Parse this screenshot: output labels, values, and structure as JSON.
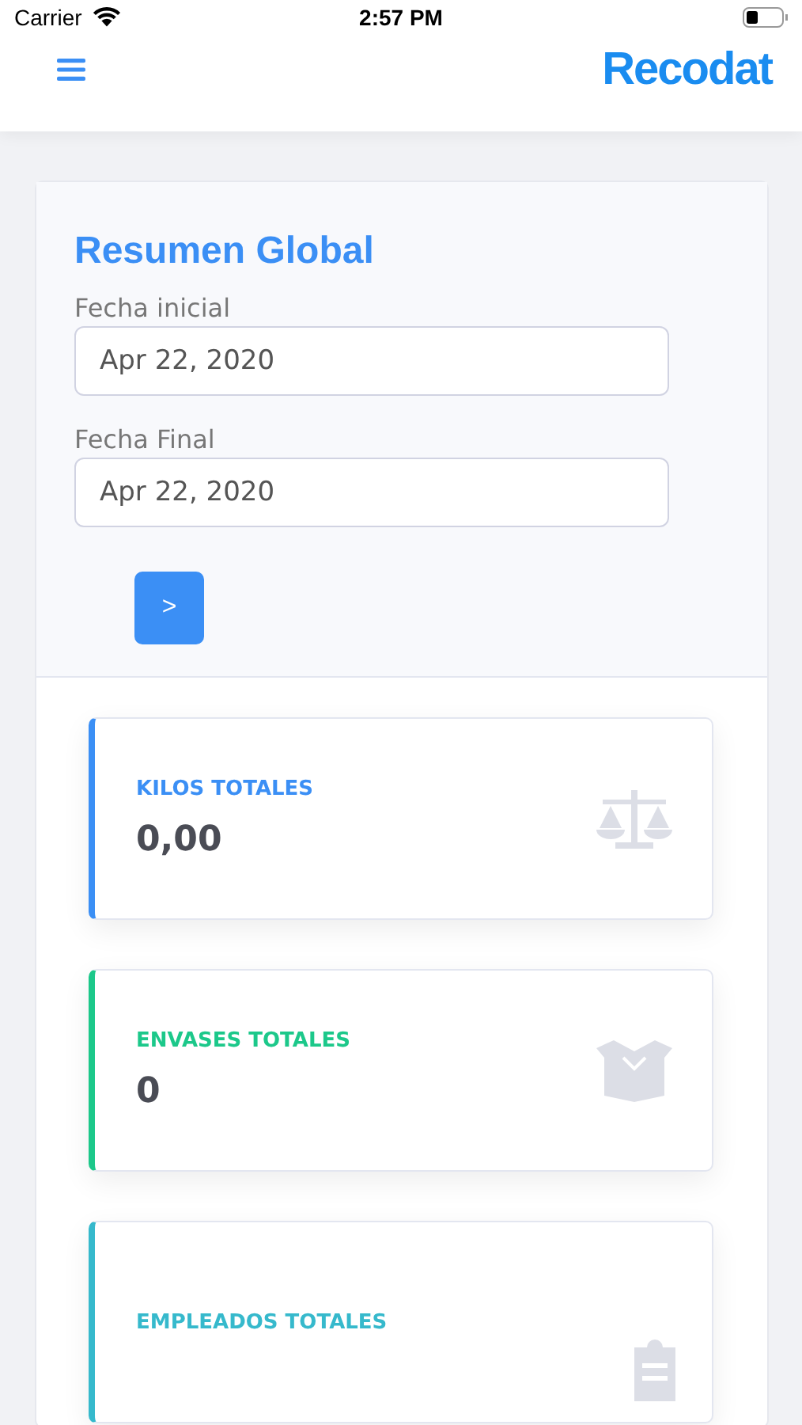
{
  "status_bar": {
    "carrier": "Carrier",
    "time": "2:57 PM"
  },
  "header": {
    "logo": "Recodat"
  },
  "summary": {
    "title": "Resumen Global",
    "fields": [
      {
        "label": "Fecha inicial",
        "value": "Apr 22, 2020"
      },
      {
        "label": "Fecha Final",
        "value": "Apr 22, 2020"
      }
    ],
    "submit": ">"
  },
  "cards": [
    {
      "kind": "scale",
      "label": "KILOS TOTALES",
      "value": "0,00",
      "color": "#3b8ff5"
    },
    {
      "kind": "box",
      "label": "ENVASES TOTALES",
      "value": "0",
      "color": "#1cc88a"
    },
    {
      "kind": "clipboard",
      "label": "EMPLEADOS TOTALES",
      "color": "#36b9cc"
    }
  ]
}
